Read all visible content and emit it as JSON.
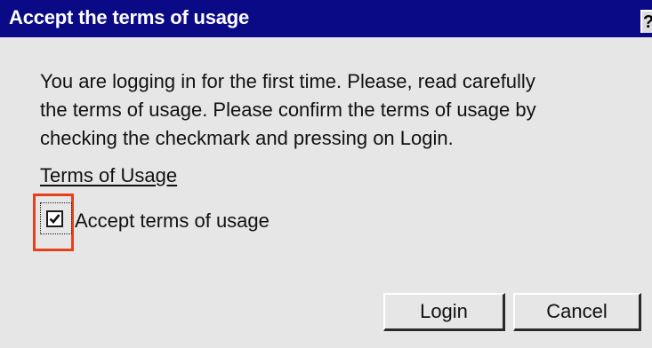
{
  "dialog": {
    "title": "Accept the terms of usage",
    "help_label": "?",
    "message_lines": [
      "You are logging in for the first time. Please, read carefully",
      "the terms of usage. Please confirm the terms of usage by",
      "checking the checkmark and pressing on Login."
    ],
    "terms_link": "Terms of Usage",
    "checkbox": {
      "label": "Accept terms of usage",
      "checked": true
    },
    "buttons": {
      "login": "Login",
      "cancel": "Cancel"
    },
    "colors": {
      "titlebar": "#0a0a86",
      "background": "#e6e6e6",
      "highlight": "#e8401c"
    }
  }
}
